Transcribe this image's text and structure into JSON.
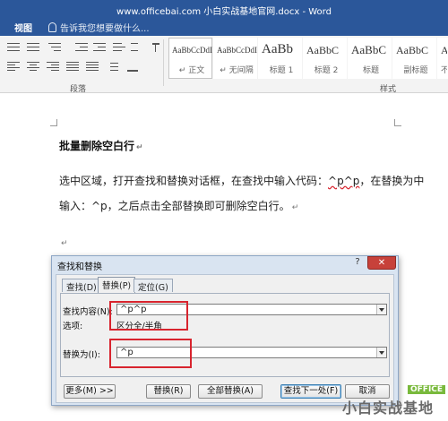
{
  "window": {
    "title": "www.officebai.com 小白实战基地官网.docx - Word"
  },
  "ribbon": {
    "tab_view": "视图",
    "tell_me": "告诉我您想要做什么...",
    "group_paragraph": "段落",
    "group_styles": "样式",
    "styles": [
      {
        "sample": "AaBbCcDdI",
        "name": "↵ 正文"
      },
      {
        "sample": "AaBbCcDdI",
        "name": "↵ 无间隔"
      },
      {
        "sample": "AaBb",
        "name": "标题 1"
      },
      {
        "sample": "AaBbC",
        "name": "标题 2"
      },
      {
        "sample": "AaBbC",
        "name": "标题"
      },
      {
        "sample": "AaBbC",
        "name": "副标题"
      },
      {
        "sample": "AaBbC",
        "name": "不明"
      }
    ]
  },
  "document": {
    "heading": "批量删除空白行",
    "para_line1_a": "选中区域，打开查找和替换对话框，在查找中输入代码：",
    "para_line1_code": "^p^p",
    "para_line1_b": "，在替换为中",
    "para_line2": "输入：^p，之后点击全部替换即可删除空白行。",
    "para_mark": "↵"
  },
  "dialog": {
    "title": "查找和替换",
    "help": "?",
    "close": "✕",
    "tabs": [
      "查找(D)",
      "替换(P)",
      "定位(G)"
    ],
    "find_label": "查找内容(N):",
    "find_value": "^p^p",
    "options_label": "选项:",
    "options_value": "区分全/半角",
    "replace_label": "替换为(I):",
    "replace_value": "^p",
    "buttons": {
      "more": "更多(M) >>",
      "replace": "替换(R)",
      "replace_all": "全部替换(A)",
      "find_next": "查找下一处(F)",
      "cancel": "取消"
    }
  },
  "watermark": {
    "badge": "OFFICE",
    "brand": "小白实战基地"
  },
  "colors": {
    "word_blue": "#2b579a",
    "highlight_red": "#d8242e",
    "close_red": "#c7413a"
  }
}
